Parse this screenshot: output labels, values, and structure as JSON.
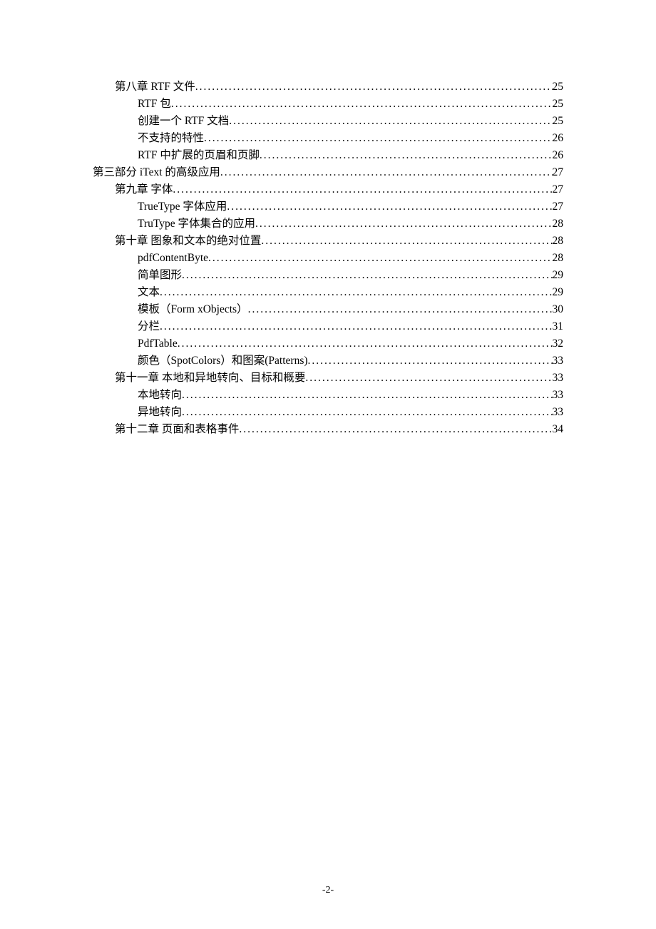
{
  "toc": [
    {
      "level": 2,
      "label": "第八章  RTF 文件 ",
      "page": "25"
    },
    {
      "level": 3,
      "label": "RTF 包 ",
      "page": "25"
    },
    {
      "level": 3,
      "label": "创建一个 RTF 文档 ",
      "page": "25"
    },
    {
      "level": 3,
      "label": "不支持的特性",
      "page": "26"
    },
    {
      "level": 3,
      "label": "RTF 中扩展的页眉和页脚 ",
      "page": "26"
    },
    {
      "level": 1,
      "label": "第三部分  iText 的高级应用 ",
      "page": "27"
    },
    {
      "level": 2,
      "label": "第九章  字体",
      "page": "27"
    },
    {
      "level": 3,
      "label": "TrueType 字体应用 ",
      "page": "27"
    },
    {
      "level": 3,
      "label": "TruType 字体集合的应用",
      "page": "28"
    },
    {
      "level": 2,
      "label": "第十章  图象和文本的绝对位置",
      "page": "28"
    },
    {
      "level": 3,
      "label": "pdfContentByte ",
      "page": "28"
    },
    {
      "level": 3,
      "label": "简单图形",
      "page": "29"
    },
    {
      "level": 3,
      "label": "文本",
      "page": "29"
    },
    {
      "level": 3,
      "label": "模板（Form xObjects） ",
      "page": "30"
    },
    {
      "level": 3,
      "label": "分栏",
      "page": "31"
    },
    {
      "level": 3,
      "label": "PdfTable ",
      "page": "32"
    },
    {
      "level": 3,
      "label": "颜色（SpotColors）和图案(Patterns) ",
      "page": "33"
    },
    {
      "level": 2,
      "label": "第十一章  本地和异地转向、目标和概要",
      "page": "33"
    },
    {
      "level": 3,
      "label": "本地转向",
      "page": "33"
    },
    {
      "level": 3,
      "label": "异地转向",
      "page": "33"
    },
    {
      "level": 2,
      "label": "第十二章  页面和表格事件",
      "page": "34"
    }
  ],
  "page_number": "-2-"
}
